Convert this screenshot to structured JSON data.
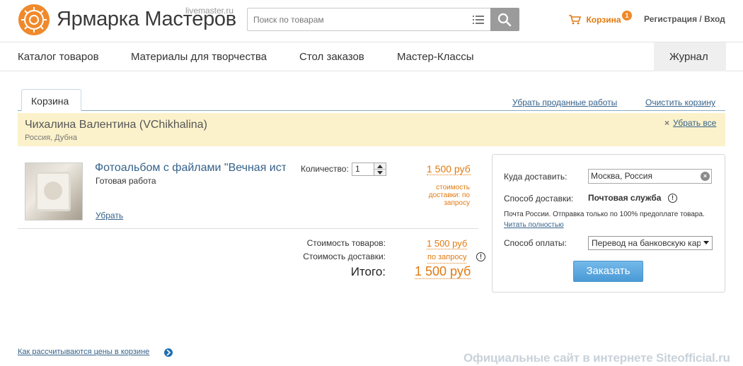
{
  "header": {
    "logo_title": "Ярмарка Мастеров",
    "logo_domain": "livemaster.ru",
    "search_placeholder": "Поиск по товарам",
    "cart_label": "Корзина",
    "cart_count": "1",
    "auth_label": "Регистрация / Вход",
    "accent_color": "#f0892b"
  },
  "nav": {
    "items": [
      "Каталог товаров",
      "Материалы для творчества",
      "Стол заказов",
      "Мастер-Классы"
    ],
    "journal": "Журнал"
  },
  "cart": {
    "tab_label": "Корзина",
    "remove_sold_link": "Убрать проданные работы",
    "clear_cart_link": "Очистить корзину",
    "seller": {
      "name": "Чихалина Валентина (VChikhalina)",
      "location": "Россия, Дубна",
      "remove_all": "Убрать все"
    },
    "item": {
      "title": "Фотоальбом с файлами \"Вечная ист",
      "type": "Готовая работа",
      "remove_link": "Убрать",
      "quantity_label": "Количество:",
      "quantity": "1",
      "price": "1 500 руб",
      "shipping_note": "стоимость доставки: по запросу"
    },
    "totals": {
      "goods_label": "Стоимость товаров:",
      "goods_value": "1 500 руб",
      "delivery_label": "Стоимость доставки:",
      "delivery_value": "по запросу",
      "total_label": "Итого:",
      "total_value": "1 500 руб"
    }
  },
  "delivery": {
    "destination_label": "Куда доставить:",
    "destination_value": "Москва, Россия",
    "method_label": "Способ доставки:",
    "method_value": "Почтовая служба",
    "note": "Почта России. Отправка только по 100% предоплате товара.",
    "note_link": "Читать полностью",
    "payment_label": "Способ оплаты:",
    "payment_value": "Перевод на банковскую кар",
    "order_button": "Заказать"
  },
  "footer": {
    "price_help_link": "Как рассчитываются цены в корзине",
    "watermark": "Официальные сайт в интернете Siteofficial.ru"
  }
}
